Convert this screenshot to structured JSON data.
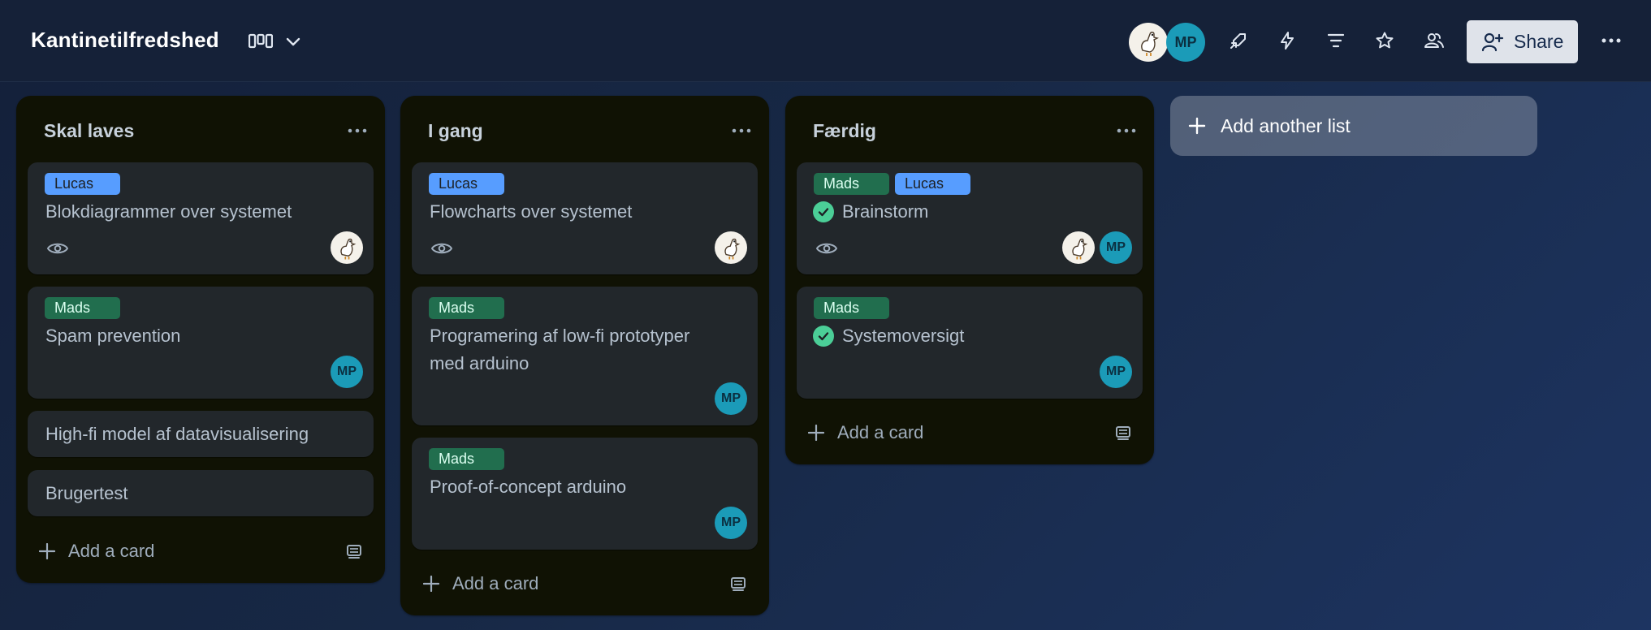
{
  "board": {
    "title": "Kantinetilfredshed",
    "view_icon": "board-view-icon",
    "view_chevron": "chevron-down-icon"
  },
  "header": {
    "members": [
      {
        "type": "duck-avatar"
      },
      {
        "initials": "MP"
      }
    ],
    "icons": [
      "power-ups-icon",
      "automation-icon",
      "filter-icon",
      "star-icon",
      "visibility-icon",
      "more-icon"
    ],
    "share_label": "Share"
  },
  "lists": [
    {
      "title": "Skal laves",
      "cards": [
        {
          "labels": [
            "Lucas"
          ],
          "title": "Blokdiagrammer over systemet",
          "watching": true,
          "members": [
            "duck"
          ]
        },
        {
          "labels": [
            "Mads"
          ],
          "title": "Spam prevention",
          "members": [
            "MP"
          ]
        },
        {
          "title": "High-fi model af datavisualisering"
        },
        {
          "title": "Brugertest"
        }
      ],
      "add_card": "Add a card"
    },
    {
      "title": "I gang",
      "cards": [
        {
          "labels": [
            "Lucas"
          ],
          "title": "Flowcharts over systemet",
          "watching": true,
          "members": [
            "duck"
          ]
        },
        {
          "labels": [
            "Mads"
          ],
          "title_lines": [
            "Programering af low-fi prototyper",
            "med arduino"
          ],
          "members": [
            "MP"
          ]
        },
        {
          "labels": [
            "Mads"
          ],
          "title": "Proof-of-concept arduino",
          "members": [
            "MP"
          ]
        }
      ],
      "add_card": "Add a card"
    },
    {
      "title": "Færdig",
      "cards": [
        {
          "labels": [
            "Mads",
            "Lucas"
          ],
          "title": "Brainstorm",
          "complete": true,
          "watching": true,
          "members": [
            "duck",
            "MP"
          ]
        },
        {
          "labels": [
            "Mads"
          ],
          "title": "Systemoversigt",
          "complete": true,
          "members": [
            "MP"
          ]
        }
      ],
      "add_card": "Add a card"
    }
  ],
  "add_list": "Add another list",
  "colors": {
    "background": "#172845",
    "list": "#101204",
    "card": "#22272b",
    "label_lucas": "#579dff",
    "label_mads": "#216e4e",
    "complete": "#4bce97",
    "avatar_mp": "#1b9bb8"
  }
}
